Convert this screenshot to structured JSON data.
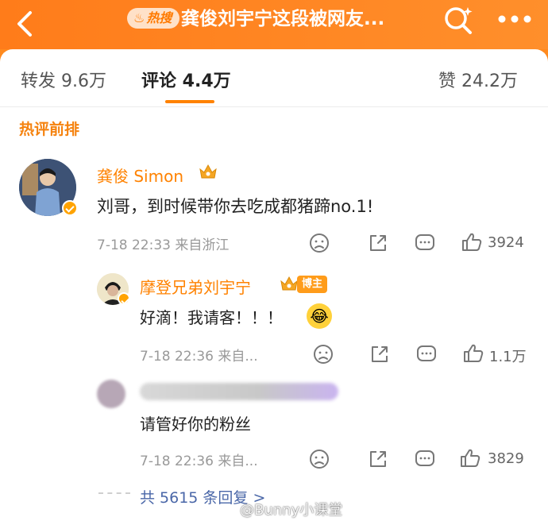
{
  "header": {
    "hot_badge": "热搜",
    "title": "龚俊刘宇宁这段被网友..."
  },
  "tabs": [
    {
      "label": "转发 9.6万"
    },
    {
      "label": "评论 4.4万"
    },
    {
      "label": "赞 24.2万"
    }
  ],
  "section_title": "热评前排",
  "comments": [
    {
      "user": "龚俊 Simon",
      "text": "刘哥，到时候带你去吃成都猪蹄no.1!",
      "time": "7-18 22:33 来自浙江",
      "likes": "3924"
    }
  ],
  "replies": [
    {
      "user": "摩登兄弟刘宇宁",
      "badge": "博主",
      "text": "好滴！我请客！！！",
      "time": "7-18 22:36 来自...",
      "likes": "1.1万"
    },
    {
      "user": "",
      "text": "请管好你的粉丝",
      "time": "7-18 22:36 来自...",
      "likes": "3829"
    }
  ],
  "more_replies": "共 5615 条回复 >",
  "watermark": "@Bunny小课堂",
  "colors": {
    "accent": "#ff8200",
    "header": "#ff8a1e",
    "link": "#4a67a8"
  }
}
